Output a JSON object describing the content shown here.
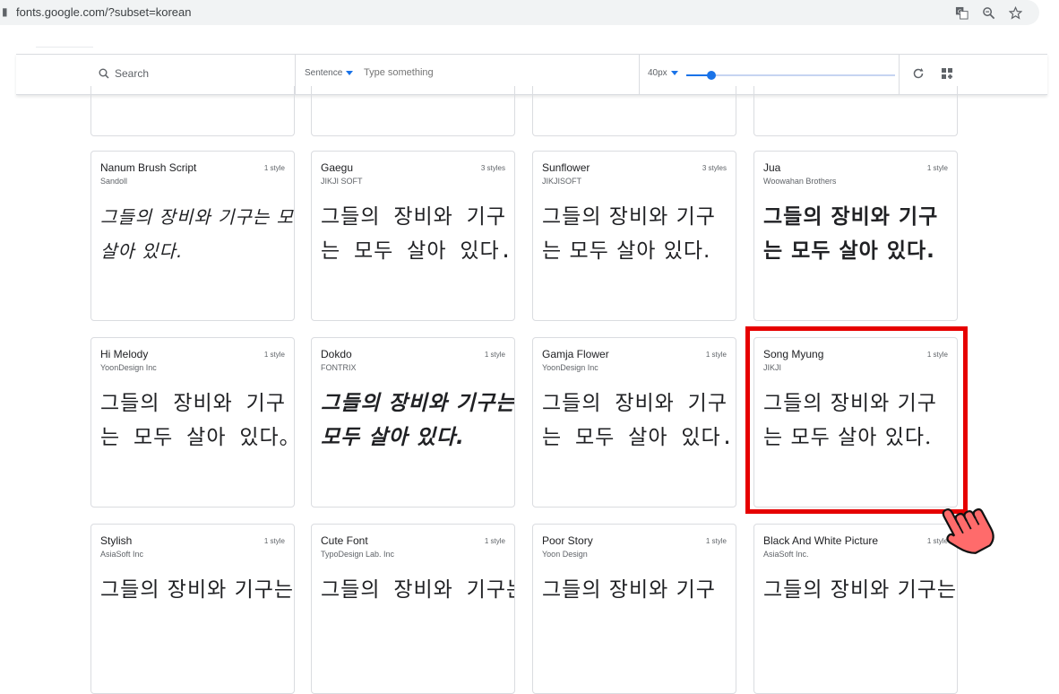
{
  "browser": {
    "url": "fonts.google.com/?subset=korean",
    "icons": [
      "translate-icon",
      "zoom-icon",
      "bookmark-star-icon"
    ]
  },
  "toolbar": {
    "search_placeholder": "Search",
    "sentence_label": "Sentence",
    "type_placeholder": "Type something",
    "size_label": "40px",
    "slider_value_fraction": 0.12,
    "accent_color": "#1a73e8"
  },
  "cards": [
    {
      "name": "Nanum Brush Script",
      "author": "Sandoll",
      "styles": "1 style",
      "sample_lines": [
        "그들의 장비와 기구는 모두",
        "살아 있다."
      ]
    },
    {
      "name": "Gaegu",
      "author": "JIKJI SOFT",
      "styles": "3 styles",
      "sample_lines": [
        "그들의 장비와 기구",
        "는 모두 살아 있다."
      ]
    },
    {
      "name": "Sunflower",
      "author": "JIKJISOFT",
      "styles": "3 styles",
      "sample_lines": [
        "그들의 장비와 기구",
        "는 모두 살아 있다."
      ]
    },
    {
      "name": "Jua",
      "author": "Woowahan Brothers",
      "styles": "1 style",
      "sample_lines": [
        "그들의 장비와 기구",
        "는 모두 살아 있다."
      ]
    },
    {
      "name": "Hi Melody",
      "author": "YoonDesign Inc",
      "styles": "1 style",
      "sample_lines": [
        "그들의 장비와 기구",
        "는 모두 살아 있다。"
      ]
    },
    {
      "name": "Dokdo",
      "author": "FONTRIX",
      "styles": "1 style",
      "sample_lines": [
        "그들의 장비와 기구는",
        "모두 살아 있다."
      ]
    },
    {
      "name": "Gamja Flower",
      "author": "YoonDesign Inc",
      "styles": "1 style",
      "sample_lines": [
        "그들의 장비와 기구",
        "는 모두 살아 있다."
      ]
    },
    {
      "name": "Song Myung",
      "author": "JIKJI",
      "styles": "1 style",
      "sample_lines": [
        "그들의 장비와 기구",
        "는 모두 살아 있다."
      ]
    },
    {
      "name": "Stylish",
      "author": "AsiaSoft Inc",
      "styles": "1 style",
      "sample_lines": [
        "그들의 장비와 기구는"
      ]
    },
    {
      "name": "Cute Font",
      "author": "TypoDesign Lab. Inc",
      "styles": "1 style",
      "sample_lines": [
        "그들의 장비와 기구는 모두"
      ]
    },
    {
      "name": "Poor Story",
      "author": "Yoon Design",
      "styles": "1 style",
      "sample_lines": [
        "그들의 장비와 기구"
      ]
    },
    {
      "name": "Black And White Picture",
      "author": "AsiaSoft Inc.",
      "styles": "1 style",
      "sample_lines": [
        "그들의 장비와 기구는"
      ]
    }
  ],
  "highlight_color": "#e60000"
}
